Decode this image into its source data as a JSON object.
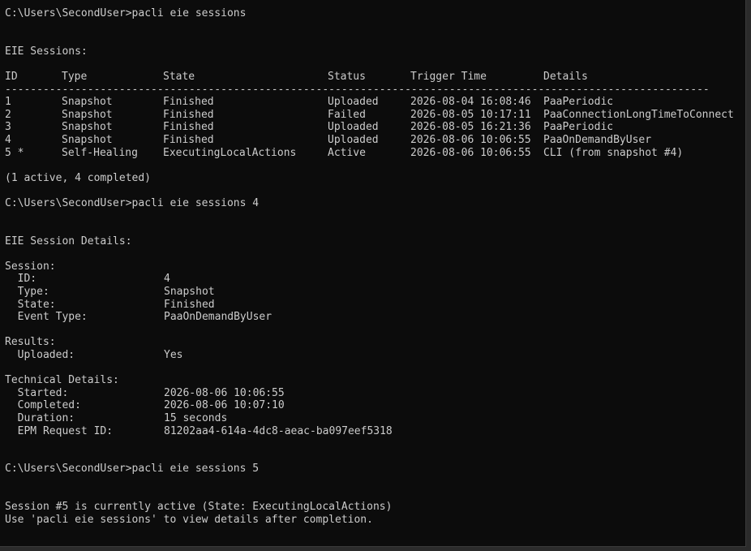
{
  "commands": {
    "prompt": "C:\\Users\\SecondUser>",
    "cmd1": "pacli eie sessions",
    "cmd2": "pacli eie sessions 4",
    "cmd3": "pacli eie sessions 5"
  },
  "sessions": {
    "heading": "EIE Sessions:",
    "headers": [
      "ID",
      "Type",
      "State",
      "Status",
      "Trigger Time",
      "Details"
    ],
    "separator": "---------------------------------------------------------------------------------------------------------------",
    "rows": [
      {
        "id": "1",
        "type": "Snapshot",
        "state": "Finished",
        "status": "Uploaded",
        "trigger": "2026-08-04 16:08:46",
        "details": "PaaPeriodic"
      },
      {
        "id": "2",
        "type": "Snapshot",
        "state": "Finished",
        "status": "Failed",
        "trigger": "2026-08-05 10:17:11",
        "details": "PaaConnectionLongTimeToConnect"
      },
      {
        "id": "3",
        "type": "Snapshot",
        "state": "Finished",
        "status": "Uploaded",
        "trigger": "2026-08-05 16:21:36",
        "details": "PaaPeriodic"
      },
      {
        "id": "4",
        "type": "Snapshot",
        "state": "Finished",
        "status": "Uploaded",
        "trigger": "2026-08-06 10:06:55",
        "details": "PaaOnDemandByUser"
      },
      {
        "id": "5 *",
        "type": "Self-Healing",
        "state": "ExecutingLocalActions",
        "status": "Active",
        "trigger": "2026-08-06 10:06:55",
        "details": "CLI (from snapshot #4)"
      }
    ],
    "summary": "(1 active, 4 completed)"
  },
  "details": {
    "heading": "EIE Session Details:",
    "session_heading": "Session:",
    "id_label": "  ID:",
    "id_value": "4",
    "type_label": "  Type:",
    "type_value": "Snapshot",
    "state_label": "  State:",
    "state_value": "Finished",
    "event_label": "  Event Type:",
    "event_value": "PaaOnDemandByUser",
    "results_heading": "Results:",
    "uploaded_label": "  Uploaded:",
    "uploaded_value": "Yes",
    "tech_heading": "Technical Details:",
    "started_label": "  Started:",
    "started_value": "2026-08-06 10:06:55",
    "completed_label": "  Completed:",
    "completed_value": "2026-08-06 10:07:10",
    "duration_label": "  Duration:",
    "duration_value": "15 seconds",
    "epm_label": "  EPM Request ID:",
    "epm_value": "81202aa4-614a-4dc8-aeac-ba097eef5318"
  },
  "active_message": {
    "line1": "Session #5 is currently active (State: ExecutingLocalActions)",
    "line2": "Use 'pacli eie sessions' to view details after completion."
  }
}
